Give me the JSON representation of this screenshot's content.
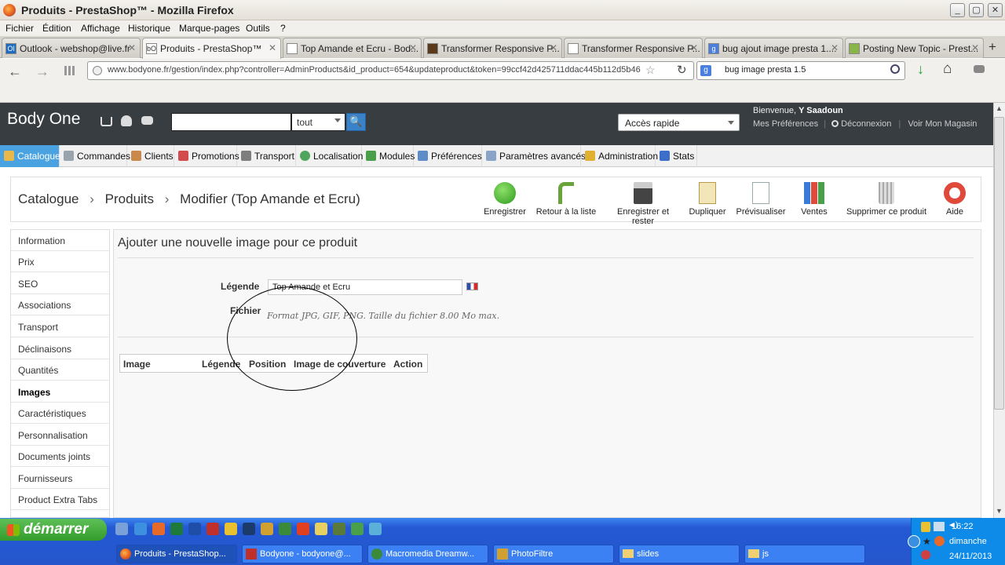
{
  "window": {
    "title": "Produits - PrestaShop™ - Mozilla Firefox",
    "btn_min": "_",
    "btn_max": "▢",
    "btn_close": "✕"
  },
  "menubar": [
    "Fichier",
    "Édition",
    "Affichage",
    "Historique",
    "Marque-pages",
    "Outils",
    "?"
  ],
  "tabs": [
    {
      "label": "Outlook - webshop@live.fr",
      "icon": "Ol"
    },
    {
      "label": "Produits - PrestaShop™",
      "icon": "bO"
    },
    {
      "label": "Top Amande et Ecru - Bod...",
      "icon": ""
    },
    {
      "label": "Transformer Responsive P...",
      "icon": ""
    },
    {
      "label": "Transformer Responsive P...",
      "icon": ""
    },
    {
      "label": "bug ajout image presta 1....",
      "icon": "g"
    },
    {
      "label": "Posting New Topic - Prest...",
      "icon": ""
    }
  ],
  "tab_close": "✕",
  "new_tab": "+",
  "navbar": {
    "url": "www.bodyone.fr/gestion/index.php?controller=AdminProducts&id_product=654&updateproduct&token=99ccf42d425711ddac445b112d5b46",
    "search": "bug image presta 1.5",
    "back": "←",
    "forward": "→",
    "reload": "↻",
    "star": "☆",
    "home": "⌂",
    "download": "↓"
  },
  "header": {
    "shop_name": "Body One",
    "search_scope": "tout",
    "search_go": "🔍",
    "quick_access": "Accès rapide",
    "welcome_prefix": "Bienvenue, ",
    "welcome_user": "Y Saadoun",
    "link_prefs": "Mes Préférences",
    "link_logout": "Déconnexion",
    "link_shop": "Voir Mon Magasin"
  },
  "mainmenu": [
    {
      "label": "Catalogue",
      "color": "#e8b84a"
    },
    {
      "label": "Commandes",
      "color": "#9aa4ad"
    },
    {
      "label": "Clients",
      "color": "#c9894b"
    },
    {
      "label": "Promotions",
      "color": "#d24c4c"
    },
    {
      "label": "Transport",
      "color": "#7e7e7e"
    },
    {
      "label": "Localisation",
      "color": "#4fa55b"
    },
    {
      "label": "Modules",
      "color": "#4aa04a"
    },
    {
      "label": "Préférences",
      "color": "#5e8cc9"
    },
    {
      "label": "Paramètres avancés",
      "color": "#8aa3c9"
    },
    {
      "label": "Administration",
      "color": "#e0b030"
    },
    {
      "label": "Stats",
      "color": "#3c6fc9"
    }
  ],
  "breadcrumb": {
    "a": "Catalogue",
    "sep": "›",
    "b": "Produits",
    "c": "Modifier (Top Amande et Ecru)"
  },
  "toolbar": [
    {
      "label": "Enregistrer",
      "icon": "save-check-icon"
    },
    {
      "label": "Retour à la liste",
      "icon": "back-arrow-icon"
    },
    {
      "label": "Enregistrer et rester",
      "icon": "floppy-icon"
    },
    {
      "label": "Dupliquer",
      "icon": "duplicate-icon"
    },
    {
      "label": "Prévisualiser",
      "icon": "preview-icon"
    },
    {
      "label": "Ventes",
      "icon": "sales-chart-icon"
    },
    {
      "label": "Supprimer ce produit",
      "icon": "trash-icon"
    },
    {
      "label": "Aide",
      "icon": "help-lifebuoy-icon"
    }
  ],
  "sidenav": [
    "Information",
    "Prix",
    "SEO",
    "Associations",
    "Transport",
    "Déclinaisons",
    "Quantités",
    "Images",
    "Caractéristiques",
    "Personnalisation",
    "Documents joints",
    "Fournisseurs",
    "Product Extra Tabs"
  ],
  "sidenav_active": "Images",
  "panel": {
    "title": "Ajouter une nouvelle image pour ce produit",
    "legend_label": "Légende",
    "legend_value": "Top Amande et Ecru",
    "file_label": "Fichier",
    "file_help": "Format JPG, GIF, PNG. Taille du fichier 8.00 Mo max.",
    "table_headers": [
      "Image",
      "Légende",
      "Position",
      "Image de couverture",
      "Action"
    ]
  },
  "taskbar": {
    "start": "démarrer",
    "tasks": [
      {
        "label": "Produits - PrestaShop...",
        "active": true
      },
      {
        "label": "Bodyone - bodyone@...",
        "active": false
      },
      {
        "label": "Macromedia Dreamw...",
        "active": false
      },
      {
        "label": "PhotoFiltre",
        "active": false
      },
      {
        "label": "slides",
        "active": false
      },
      {
        "label": "js",
        "active": false
      }
    ],
    "time": "16:22",
    "day": "dimanche",
    "date": "24/11/2013"
  }
}
